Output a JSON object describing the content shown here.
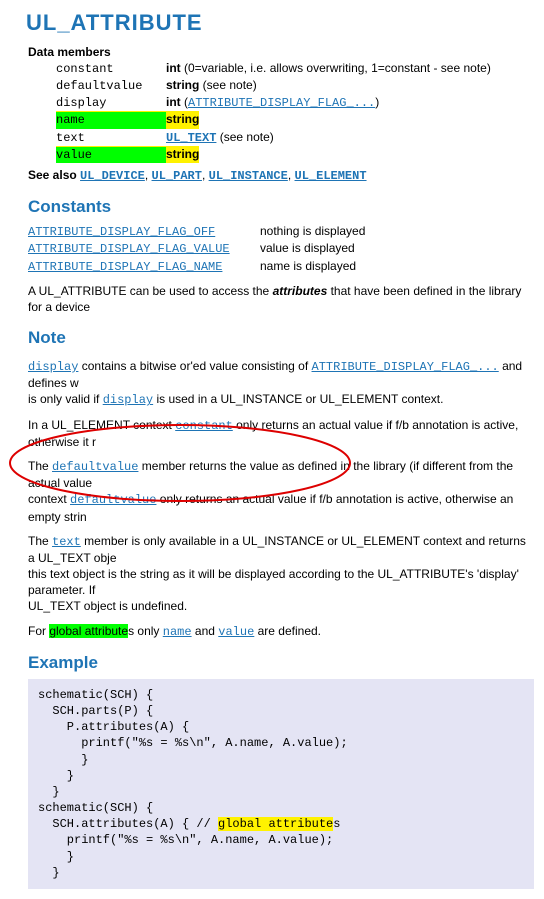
{
  "title": "UL_ATTRIBUTE",
  "data_members_label": "Data members",
  "members": [
    {
      "name": "constant",
      "type": "int",
      "extra": " (0=variable, i.e. allows overwriting, 1=constant - see note)",
      "link": false,
      "row_hl": false,
      "name_hl": false
    },
    {
      "name": "defaultvalue",
      "type": "string",
      "extra": " (see note)",
      "link": false,
      "row_hl": false,
      "name_hl": false
    },
    {
      "name": "display",
      "type": "int",
      "extra2_mono": "ATTRIBUTE_DISPLAY_FLAG_...",
      "link": false,
      "row_hl": false,
      "name_hl": false
    },
    {
      "name": "name",
      "type": "string",
      "extra": "",
      "link": false,
      "row_hl": true,
      "name_hl": true
    },
    {
      "name": "text",
      "type": "UL_TEXT",
      "extra": " (see note)",
      "link": true,
      "row_hl": false,
      "name_hl": false
    },
    {
      "name": "value",
      "type": "string",
      "extra": "",
      "link": false,
      "row_hl": true,
      "name_hl": true
    }
  ],
  "see_also_label": "See also",
  "see_also": [
    "UL_DEVICE",
    "UL_PART",
    "UL_INSTANCE",
    "UL_ELEMENT"
  ],
  "constants_heading": "Constants",
  "constants": [
    {
      "name": "ATTRIBUTE_DISPLAY_FLAG_OFF",
      "desc": "nothing is displayed"
    },
    {
      "name": "ATTRIBUTE_DISPLAY_FLAG_VALUE",
      "desc": "value is displayed"
    },
    {
      "name": "ATTRIBUTE_DISPLAY_FLAG_NAME",
      "desc": "name is displayed"
    }
  ],
  "p1": {
    "a": "A UL_ATTRIBUTE can be used to access the ",
    "b": "attributes",
    "c": " that have been defined in the library for a device"
  },
  "note_heading": "Note",
  "p2": {
    "a": " contains a bitwise or'ed value consisting of ",
    "flag": "ATTRIBUTE_DISPLAY_FLAG_...",
    "b": " and defines w",
    "c": "is only valid if ",
    "d": " is used in a UL_INSTANCE or UL_ELEMENT context.",
    "display1": "display",
    "display2": "display"
  },
  "p3": {
    "a": "In a UL_ELEMENT context ",
    "kw": "constant",
    "b": " only returns an actual value if f/b annotation is active, otherwise it r"
  },
  "p4": {
    "a": "The ",
    "kw1": "defaultvalue",
    "b": " member returns the value as defined in the library (if different from the actual value",
    "c": "context ",
    "kw2": "defaultvalue",
    "d": " only returns an actual value if f/b annotation is active, otherwise an empty strin"
  },
  "p5": {
    "a": "The ",
    "kw": "text",
    "b": " member is only available in a UL_INSTANCE or UL_ELEMENT context and returns a UL_TEXT obje",
    "c": "this text object is the string as it will be displayed according to the UL_ATTRIBUTE's 'display' parameter. If ",
    "d": "UL_TEXT object is undefined."
  },
  "p6": {
    "a": "For ",
    "hl": "global attribute",
    "b": "s only ",
    "kw1": "name",
    "c": " and ",
    "kw2": "value",
    "d": " are defined."
  },
  "example_heading": "Example",
  "code": {
    "l1": "schematic(SCH) {",
    "l2": "  SCH.parts(P) {",
    "l3": "    P.attributes(A) {",
    "l4": "      printf(\"%s = %s\\n\", A.name, A.value);",
    "l5": "      }",
    "l6": "    }",
    "l7": "  }",
    "l8": "schematic(SCH) {",
    "l9a": "  SCH.attributes(A) { // ",
    "l9hl": "global attribute",
    "l9b": "s",
    "l10": "    printf(\"%s = %s\\n\", A.name, A.value);",
    "l11": "    }",
    "l12": "  }"
  }
}
